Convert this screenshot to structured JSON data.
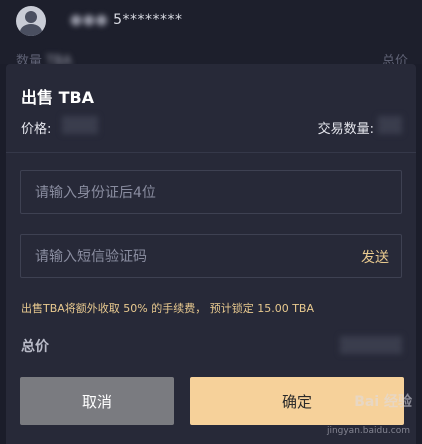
{
  "background": {
    "user_name_suffix": "5********",
    "sub_left": "数量",
    "sub_left_blur": "  TBA",
    "sub_right": "总价"
  },
  "sheet": {
    "title": "出售 TBA",
    "price_label": "价格:",
    "qty_label": "交易数量:",
    "id_field": {
      "placeholder": "请输入身份证后4位",
      "value": ""
    },
    "sms_field": {
      "placeholder": "请输入短信验证码",
      "value": ""
    },
    "send_label": "发送",
    "fee_note": "出售TBA将额外收取 50% 的手续费，  预计锁定 15.00 TBA",
    "total_label": "总价",
    "cancel_label": "取消",
    "confirm_label": "确定"
  },
  "watermark": {
    "text": "Bai 经验",
    "sub": "jingyan.baidu.com"
  },
  "colors": {
    "accent": "#e8c98f",
    "confirm_bg": "#f6d19a",
    "cancel_bg": "#7a7b80",
    "sheet_bg": "#272938",
    "page_bg": "#1b1d2a"
  }
}
